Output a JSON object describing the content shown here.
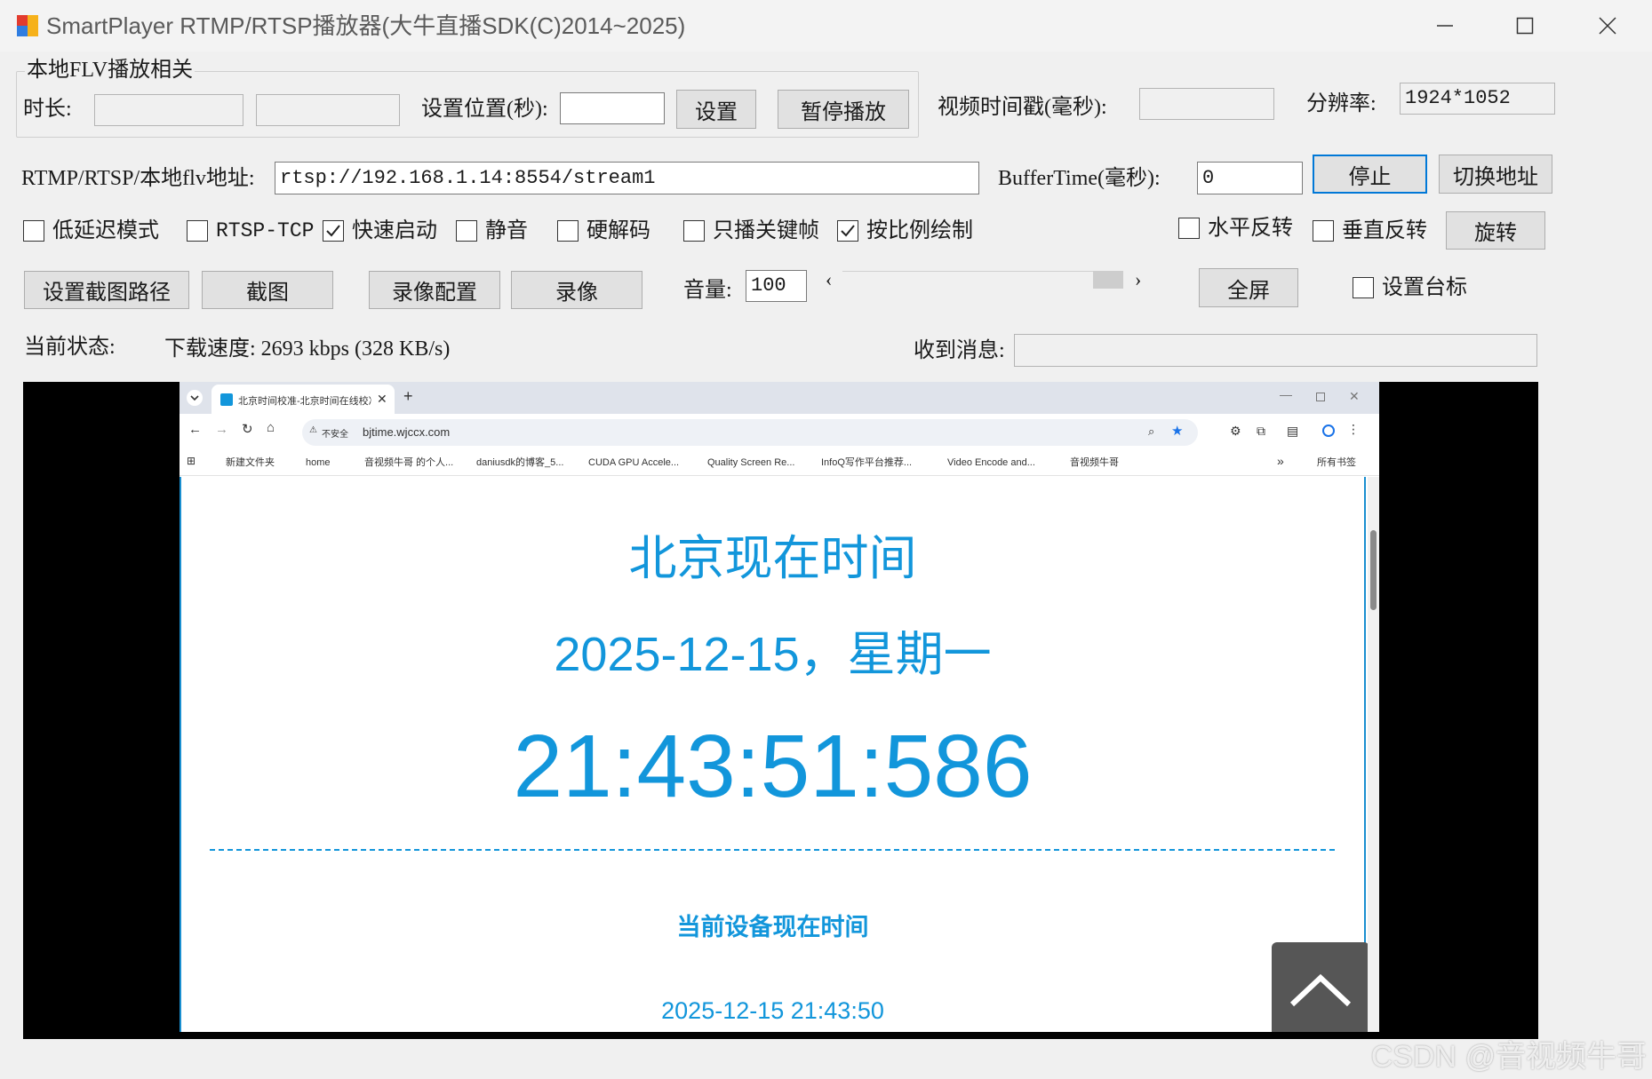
{
  "window": {
    "title": "SmartPlayer RTMP/RTSP播放器(大牛直播SDK(C)2014~2025)"
  },
  "flv_group": {
    "title": "本地FLV播放相关",
    "duration_label": "时长:",
    "duration_value": "",
    "duration_value2": "",
    "set_pos_label": "设置位置(秒):",
    "set_pos_value": "",
    "set_button": "设置",
    "pause_button": "暂停播放"
  },
  "timestamp": {
    "label": "视频时间戳(毫秒):",
    "value": ""
  },
  "resolution": {
    "label": "分辨率:",
    "value": "1924*1052"
  },
  "url": {
    "label": "RTMP/RTSP/本地flv地址:",
    "value": "rtsp://192.168.1.14:8554/stream1"
  },
  "buffer": {
    "label": "BufferTime(毫秒):",
    "value": "0"
  },
  "stop_button": "停止",
  "switch_button": "切换地址",
  "options": {
    "low_latency": {
      "label": "低延迟模式",
      "checked": false
    },
    "rtsp_tcp": {
      "label": "RTSP-TCP",
      "checked": false
    },
    "fast_start": {
      "label": "快速启动",
      "checked": true
    },
    "mute": {
      "label": "静音",
      "checked": false
    },
    "hw_decode": {
      "label": "硬解码",
      "checked": false
    },
    "keyframe_only": {
      "label": "只播关键帧",
      "checked": false
    },
    "keep_ratio": {
      "label": "按比例绘制",
      "checked": true
    },
    "flip_h": {
      "label": "水平反转",
      "checked": false
    },
    "flip_v": {
      "label": "垂直反转",
      "checked": false
    }
  },
  "rotate_button": "旋转",
  "actions": {
    "snapshot_path": "设置截图路径",
    "snapshot": "截图",
    "record_config": "录像配置",
    "record": "录像",
    "fullscreen": "全屏"
  },
  "volume": {
    "label": "音量:",
    "value": "100",
    "arrow_left": "‹",
    "arrow_right": "›"
  },
  "logo_option": {
    "label": "设置台标",
    "checked": false
  },
  "status": {
    "label": "当前状态:",
    "speed": "下载速度: 2693 kbps (328 KB/s)",
    "message_label": "收到消息:",
    "message_value": ""
  },
  "video": {
    "browser": {
      "tab_title": "北京时间校准-北京时间在线校准",
      "new_tab": "+",
      "insecure_label": "不安全",
      "address": "bjtime.wjccx.com",
      "bookmarks": [
        "新建文件夹",
        "home",
        "音视频牛哥 的个人...",
        "daniusdk的博客_5...",
        "CUDA GPU Accele...",
        "Quality Screen Re...",
        "InfoQ写作平台推荐...",
        "Video Encode and...",
        "音视频牛哥"
      ],
      "bookmarks_more": "»",
      "all_bookmarks": "所有书签"
    },
    "page": {
      "heading": "北京现在时间",
      "date": "2025-12-15，星期一",
      "time": "21:43:51:586",
      "device_heading": "当前设备现在时间",
      "device_time": "2025-12-15 21:43:50"
    }
  },
  "watermark": "CSDN @音视频牛哥"
}
